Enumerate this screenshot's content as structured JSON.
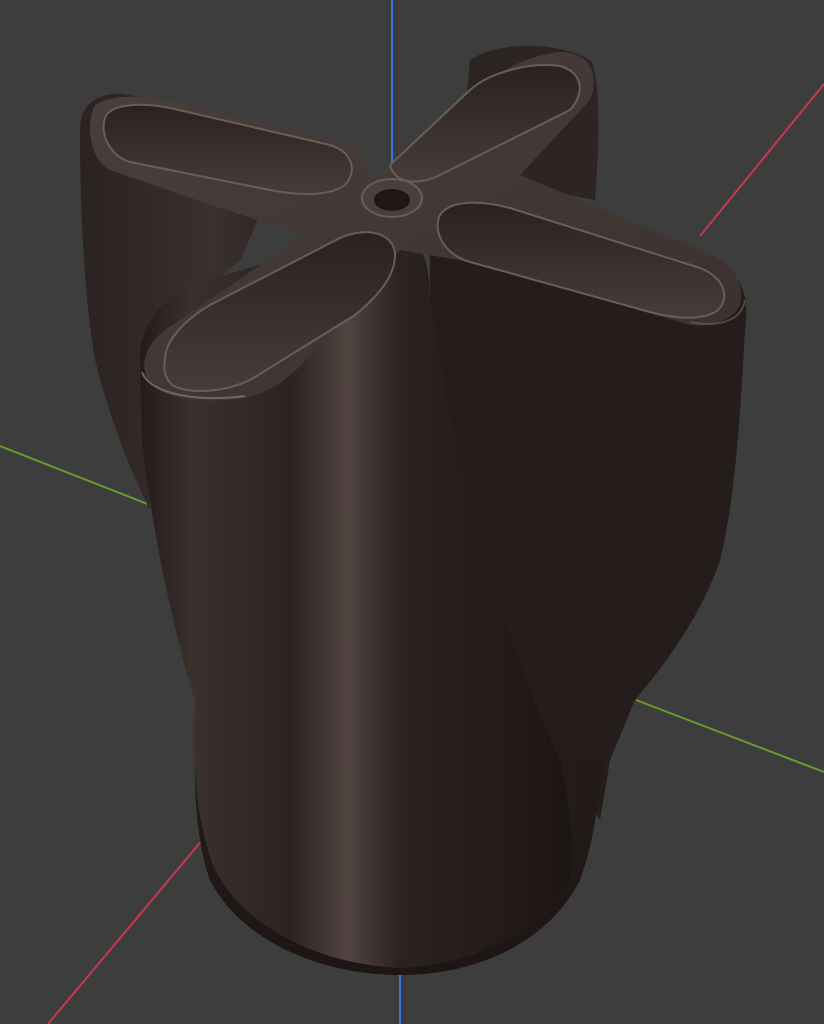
{
  "viewport": {
    "background_color": "#3d3d3d",
    "axes": {
      "x_axis_color": "#c8384d",
      "y_axis_color": "#6a9a2a",
      "z_axis_color": "#3a78d6"
    },
    "object": {
      "shape": "four-lobed cross vase",
      "body_color": "#2e2624",
      "highlight_color": "#5a4e4a",
      "inner_color": "#3e3432"
    }
  }
}
